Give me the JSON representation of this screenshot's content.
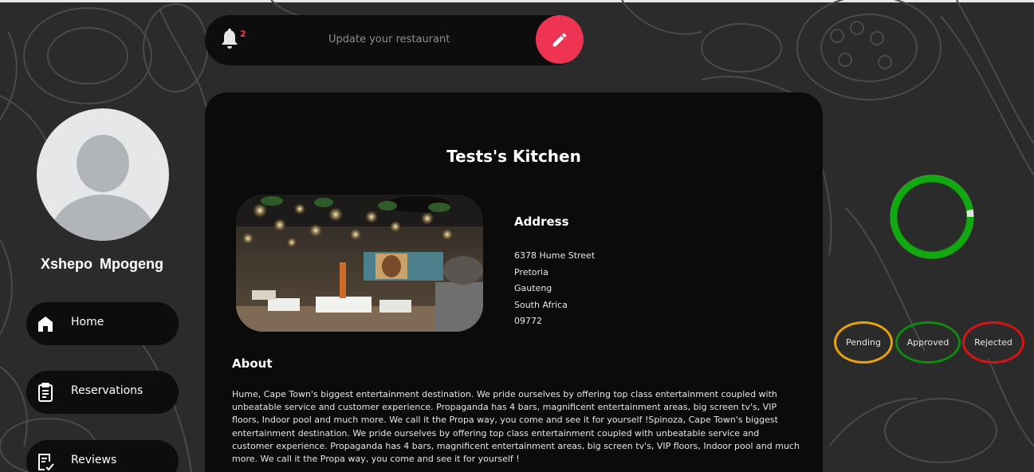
{
  "topbar": {
    "notification_count": "2",
    "update_text": "Update your restaurant"
  },
  "profile": {
    "name": "Xshepo  Mpogeng"
  },
  "nav": {
    "items": [
      {
        "label": "Home",
        "icon": "home-icon"
      },
      {
        "label": "Reservations",
        "icon": "clipboard-icon"
      },
      {
        "label": "Reviews",
        "icon": "review-checklist-icon"
      }
    ]
  },
  "restaurant": {
    "name": "Tests's Kitchen",
    "address_heading": "Address",
    "address": [
      "6378 Hume Street",
      "Pretoria",
      "Gauteng",
      "South Africa",
      "09772"
    ],
    "about_heading": "About",
    "about": "Hume, Cape Town's biggest entertainment destination. We pride ourselves by offering top class entertainment coupled with unbeatable service and customer experience. Propaganda has 4 bars, magnificent entertainment areas, big screen tv's, VIP floors, Indoor pool and much more. We call it the Propa way, you come and see it for yourself !Spinoza, Cape Town's biggest entertainment destination. We pride ourselves by offering top class entertainment coupled with unbeatable service and customer experience. Propaganda has 4 bars, magnificent entertainment areas, big screen tv's, VIP floors, Indoor pool and much more. We call it the Propa way, you come and see it for yourself !"
  },
  "status": {
    "pending": "Pending",
    "approved": "Approved",
    "rejected": "Rejected"
  },
  "colors": {
    "accent": "#ee3353",
    "pending": "#e8a20c",
    "approved": "#0f8a0f",
    "rejected": "#d61414",
    "ring": "#12a812"
  }
}
